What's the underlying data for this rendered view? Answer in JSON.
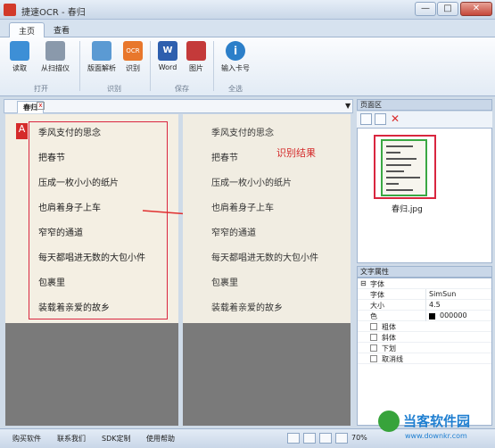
{
  "window": {
    "title": "捷速OCR - 春归",
    "min": "—",
    "max": "□",
    "close": "✕"
  },
  "tabs": [
    "主页",
    "查看"
  ],
  "ribbon": {
    "groups": [
      "打开",
      "识别",
      "保存",
      "全选"
    ],
    "buttons": {
      "read": "读取",
      "scan": "从扫描仪",
      "layout": "版面解析",
      "recognize": "识别",
      "word": "Word",
      "image": "图片",
      "serial": "输入卡号"
    }
  },
  "doc_tab": {
    "label": "春归",
    "close": "x",
    "dropdown": "▼"
  },
  "lines": [
    "季风支付的思念",
    "把春节",
    "压成一枚小小的纸片",
    "也肩着身子上车",
    "窄窄的通道",
    "每天都唱进无数的大包小件",
    "包裹里",
    "装载着亲爱的故乡"
  ],
  "result_lines": [
    "季风支付的思念",
    "把春节",
    "压成一枚小小的纸片",
    "也肩着身子上车",
    "窄窄的通道",
    "每天都唱进无数的大包小件",
    "包裹里",
    "装载着亲爱的故乡"
  ],
  "result_label": "识别结果",
  "page_panel": {
    "title": "页面区",
    "thumb_name": "春归.jpg"
  },
  "text_panel": {
    "title": "文字属性",
    "section": "字体",
    "props": [
      {
        "k": "字体",
        "v": "SimSun"
      },
      {
        "k": "大小",
        "v": "4.5"
      },
      {
        "k": "色",
        "v": "000000"
      }
    ],
    "checks": [
      "粗体",
      "斜体",
      "下划",
      "取消线"
    ]
  },
  "status": {
    "links": [
      "购买软件",
      "联系我们",
      "SDK定制",
      "使用帮助"
    ],
    "zoom": "70%"
  },
  "watermark": {
    "name": "当客软件园",
    "url": "www.downkr.com"
  },
  "colors": {
    "accent_red": "#d9263f",
    "result_green": "#3aa843"
  }
}
